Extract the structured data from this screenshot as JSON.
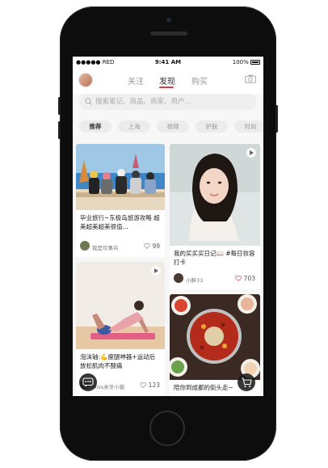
{
  "status_bar": {
    "carrier": "●●●●● RED",
    "time": "9:41 AM",
    "battery": "100%"
  },
  "header": {
    "tabs": [
      {
        "label": "关注",
        "active": false
      },
      {
        "label": "发现",
        "active": true
      },
      {
        "label": "购买",
        "active": false
      }
    ],
    "accent": "#e03c43"
  },
  "search": {
    "placeholder": "搜索笔记、商品、商家、用户..."
  },
  "categories": [
    {
      "label": "推荐",
      "active": true
    },
    {
      "label": "上海",
      "active": false
    },
    {
      "label": "视频",
      "active": false
    },
    {
      "label": "护肤",
      "active": false
    },
    {
      "label": "时尚",
      "active": false
    }
  ],
  "feed": {
    "left": [
      {
        "title": "毕业旅行~东极岛旅游攻略 超美超美超美很值...",
        "author": "我是坎事兵",
        "likes": "99",
        "image": "friends-seaside-photo"
      },
      {
        "title": "泡沫轴:💪瘦腿神器+运动后放松肌肉不酸痛",
        "author": "Miss米牙小猫",
        "likes": "123",
        "image": "yoga-stretch-photo",
        "video": true
      }
    ],
    "right": [
      {
        "title": "我的买买买日记📖 #每日妆容打卡",
        "author": "小胖33",
        "likes": "703",
        "image": "portrait-woman-photo",
        "video": true
      },
      {
        "title": "陪你到成都的街头走~",
        "author": "",
        "likes": "",
        "image": "hotpot-photo"
      }
    ]
  },
  "icons": {
    "camera": "camera-icon",
    "search": "search-icon",
    "chat": "chat-icon",
    "cart": "cart-icon",
    "heart": "heart-icon",
    "play": "play-icon"
  }
}
